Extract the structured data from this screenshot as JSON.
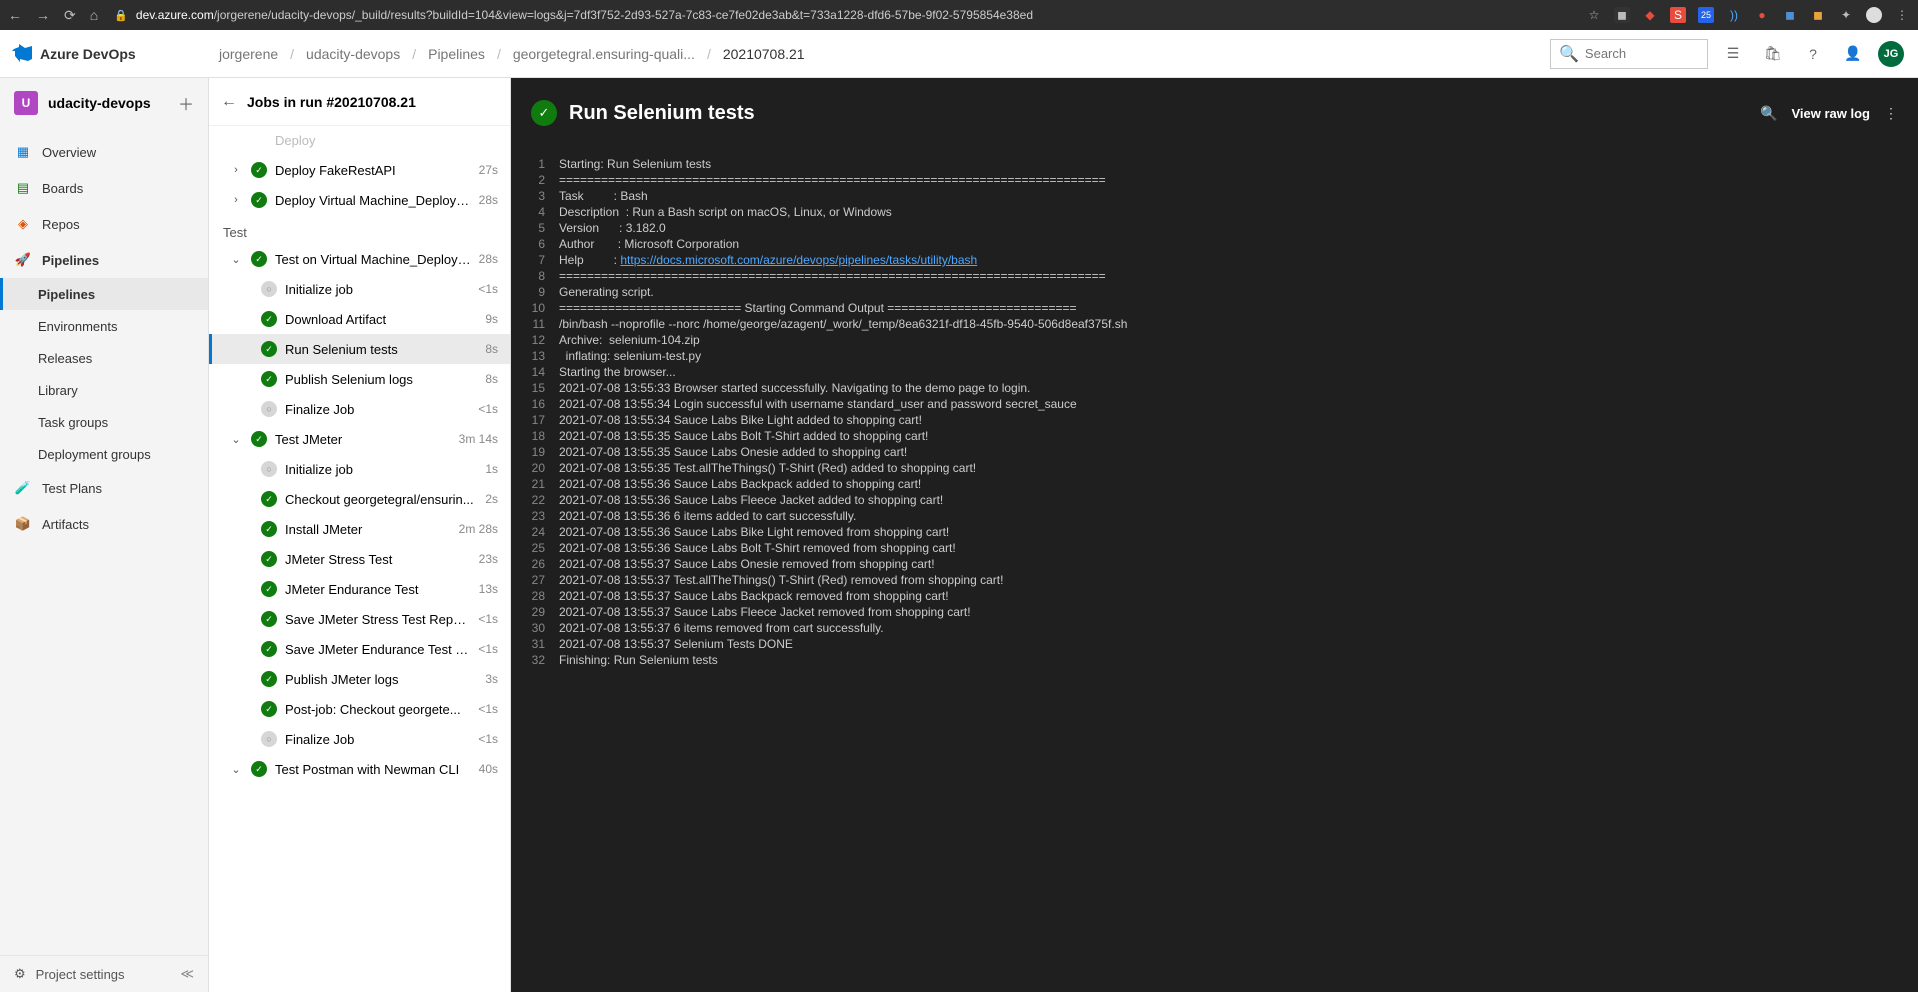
{
  "browser": {
    "url_host": "dev.azure.com",
    "url_path": "/jorgerene/udacity-devops/_build/results?buildId=104&view=logs&j=7df3f752-2d93-527a-7c83-ce7fe02de3ab&t=733a1228-dfd6-57be-9f02-5795854e38ed"
  },
  "header": {
    "brand": "Azure DevOps",
    "breadcrumb": [
      "jorgerene",
      "udacity-devops",
      "Pipelines",
      "georgetegral.ensuring-quali...",
      "20210708.21"
    ],
    "search_placeholder": "Search",
    "user_initials": "JG"
  },
  "left_nav": {
    "project_initial": "U",
    "project_name": "udacity-devops",
    "items": [
      {
        "icon": "overview",
        "label": "Overview"
      },
      {
        "icon": "boards",
        "label": "Boards"
      },
      {
        "icon": "repos",
        "label": "Repos"
      },
      {
        "icon": "pipelines",
        "label": "Pipelines",
        "section_active": true,
        "children": [
          {
            "label": "Pipelines",
            "active": true
          },
          {
            "label": "Environments"
          },
          {
            "label": "Releases"
          },
          {
            "label": "Library"
          },
          {
            "label": "Task groups"
          },
          {
            "label": "Deployment groups"
          }
        ]
      },
      {
        "icon": "test",
        "label": "Test Plans"
      },
      {
        "icon": "artifacts",
        "label": "Artifacts"
      }
    ],
    "bottom_label": "Project settings"
  },
  "middle_panel": {
    "title": "Jobs in run #20210708.21",
    "rows": [
      {
        "type": "job",
        "chevron": "h",
        "status": "",
        "label": "Deploy",
        "duration": "",
        "faded": true
      },
      {
        "type": "job",
        "chevron": ">",
        "status": "success",
        "label": "Deploy FakeRestAPI",
        "duration": "27s"
      },
      {
        "type": "job",
        "chevron": ">",
        "status": "success",
        "label": "Deploy Virtual Machine_Deploy_...",
        "duration": "28s"
      },
      {
        "type": "stage",
        "label": "Test"
      },
      {
        "type": "job",
        "chevron": "v",
        "status": "success",
        "label": "Test on Virtual Machine_Deploy_...",
        "duration": "28s"
      },
      {
        "type": "step",
        "status": "skip",
        "label": "Initialize job",
        "duration": "<1s"
      },
      {
        "type": "step",
        "status": "success",
        "label": "Download Artifact",
        "duration": "9s"
      },
      {
        "type": "step",
        "status": "success",
        "label": "Run Selenium tests",
        "duration": "8s",
        "selected": true
      },
      {
        "type": "step",
        "status": "success",
        "label": "Publish Selenium logs",
        "duration": "8s"
      },
      {
        "type": "step",
        "status": "skip",
        "label": "Finalize Job",
        "duration": "<1s"
      },
      {
        "type": "job",
        "chevron": "v",
        "status": "success",
        "label": "Test JMeter",
        "duration": "3m 14s"
      },
      {
        "type": "step",
        "status": "skip",
        "label": "Initialize job",
        "duration": "1s"
      },
      {
        "type": "step",
        "status": "success",
        "label": "Checkout georgetegral/ensurin...",
        "duration": "2s"
      },
      {
        "type": "step",
        "status": "success",
        "label": "Install JMeter",
        "duration": "2m 28s"
      },
      {
        "type": "step",
        "status": "success",
        "label": "JMeter Stress Test",
        "duration": "23s"
      },
      {
        "type": "step",
        "status": "success",
        "label": "JMeter Endurance Test",
        "duration": "13s"
      },
      {
        "type": "step",
        "status": "success",
        "label": "Save JMeter Stress Test Repor...",
        "duration": "<1s"
      },
      {
        "type": "step",
        "status": "success",
        "label": "Save JMeter Endurance Test R...",
        "duration": "<1s"
      },
      {
        "type": "step",
        "status": "success",
        "label": "Publish JMeter logs",
        "duration": "3s"
      },
      {
        "type": "step",
        "status": "success",
        "label": "Post-job: Checkout georgete...",
        "duration": "<1s"
      },
      {
        "type": "step",
        "status": "skip",
        "label": "Finalize Job",
        "duration": "<1s"
      },
      {
        "type": "job",
        "chevron": "v",
        "status": "success",
        "label": "Test Postman with Newman CLI",
        "duration": "40s"
      }
    ]
  },
  "log": {
    "title": "Run Selenium tests",
    "raw_label": "View raw log",
    "lines": [
      {
        "n": 1,
        "cls": "c-cyan",
        "t": "Starting: Run Selenium tests"
      },
      {
        "n": 2,
        "cls": "",
        "t": "=============================================================================="
      },
      {
        "n": 3,
        "cls": "",
        "t": "Task         : Bash"
      },
      {
        "n": 4,
        "cls": "",
        "t": "Description  : Run a Bash script on macOS, Linux, or Windows"
      },
      {
        "n": 5,
        "cls": "",
        "t": "Version      : 3.182.0"
      },
      {
        "n": 6,
        "cls": "",
        "t": "Author       : Microsoft Corporation"
      },
      {
        "n": 7,
        "cls": "",
        "t": "Help         : ",
        "link": "https://docs.microsoft.com/azure/devops/pipelines/tasks/utility/bash"
      },
      {
        "n": 8,
        "cls": "",
        "t": "=============================================================================="
      },
      {
        "n": 9,
        "cls": "",
        "t": "Generating script."
      },
      {
        "n": 10,
        "cls": "",
        "t": "========================== Starting Command Output ==========================="
      },
      {
        "n": 11,
        "cls": "c-cmd",
        "t": "/bin/bash --noprofile --norc /home/george/azagent/_work/_temp/8ea6321f-df18-45fb-9540-506d8eaf375f.sh"
      },
      {
        "n": 12,
        "cls": "",
        "t": "Archive:  selenium-104.zip"
      },
      {
        "n": 13,
        "cls": "",
        "t": "  inflating: selenium-test.py"
      },
      {
        "n": 14,
        "cls": "",
        "t": "Starting the browser..."
      },
      {
        "n": 15,
        "cls": "",
        "t": "2021-07-08 13:55:33 Browser started successfully. Navigating to the demo page to login."
      },
      {
        "n": 16,
        "cls": "",
        "t": "2021-07-08 13:55:34 Login successful with username standard_user and password secret_sauce"
      },
      {
        "n": 17,
        "cls": "",
        "t": "2021-07-08 13:55:34 Sauce Labs Bike Light added to shopping cart!"
      },
      {
        "n": 18,
        "cls": "",
        "t": "2021-07-08 13:55:35 Sauce Labs Bolt T-Shirt added to shopping cart!"
      },
      {
        "n": 19,
        "cls": "",
        "t": "2021-07-08 13:55:35 Sauce Labs Onesie added to shopping cart!"
      },
      {
        "n": 20,
        "cls": "",
        "t": "2021-07-08 13:55:35 Test.allTheThings() T-Shirt (Red) added to shopping cart!"
      },
      {
        "n": 21,
        "cls": "",
        "t": "2021-07-08 13:55:36 Sauce Labs Backpack added to shopping cart!"
      },
      {
        "n": 22,
        "cls": "",
        "t": "2021-07-08 13:55:36 Sauce Labs Fleece Jacket added to shopping cart!"
      },
      {
        "n": 23,
        "cls": "",
        "t": "2021-07-08 13:55:36 6 items added to cart successfully."
      },
      {
        "n": 24,
        "cls": "",
        "t": "2021-07-08 13:55:36 Sauce Labs Bike Light removed from shopping cart!"
      },
      {
        "n": 25,
        "cls": "",
        "t": "2021-07-08 13:55:36 Sauce Labs Bolt T-Shirt removed from shopping cart!"
      },
      {
        "n": 26,
        "cls": "",
        "t": "2021-07-08 13:55:37 Sauce Labs Onesie removed from shopping cart!"
      },
      {
        "n": 27,
        "cls": "",
        "t": "2021-07-08 13:55:37 Test.allTheThings() T-Shirt (Red) removed from shopping cart!"
      },
      {
        "n": 28,
        "cls": "",
        "t": "2021-07-08 13:55:37 Sauce Labs Backpack removed from shopping cart!"
      },
      {
        "n": 29,
        "cls": "",
        "t": "2021-07-08 13:55:37 Sauce Labs Fleece Jacket removed from shopping cart!"
      },
      {
        "n": 30,
        "cls": "",
        "t": "2021-07-08 13:55:37 6 items removed from cart successfully."
      },
      {
        "n": 31,
        "cls": "",
        "t": "2021-07-08 13:55:37 Selenium Tests DONE"
      },
      {
        "n": 32,
        "cls": "c-green",
        "t": "Finishing: Run Selenium tests"
      }
    ]
  }
}
